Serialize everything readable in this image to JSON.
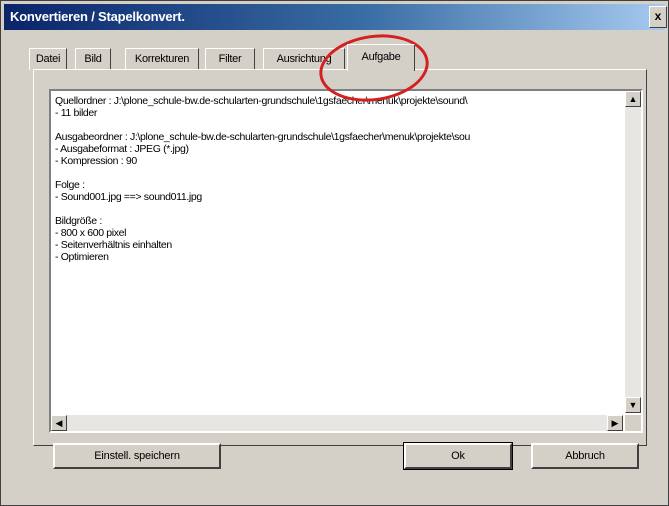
{
  "window": {
    "title": "Konvertieren / Stapelkonvert.",
    "close_label": "x"
  },
  "tabs": [
    {
      "label": "Datei"
    },
    {
      "label": "Bild"
    },
    {
      "label": "Korrekturen"
    },
    {
      "label": "Filter"
    },
    {
      "label": "Ausrichtung"
    },
    {
      "label": "Aufgabe"
    }
  ],
  "active_tab": "Aufgabe",
  "task_text": {
    "lines": [
      "Quellordner : J:\\plone_schule-bw.de-schularten-grundschule\\1gsfaecher\\menuk\\projekte\\sound\\",
      "- 11 bilder",
      "",
      "Ausgabeordner : J:\\plone_schule-bw.de-schularten-grundschule\\1gsfaecher\\menuk\\projekte\\sou",
      "- Ausgabeformat : JPEG (*.jpg)",
      "- Kompression : 90",
      "",
      "Folge :",
      "- Sound001.jpg ==> sound011.jpg",
      "",
      "Bildgröße :",
      "- 800 x 600 pixel",
      "- Seitenverhältnis einhalten",
      "- Optimieren"
    ]
  },
  "buttons": {
    "save_settings": "Einstell. speichern",
    "ok": "Ok",
    "cancel": "Abbruch"
  },
  "colors": {
    "annotation_circle": "#d42020",
    "titlebar": "#0a246a"
  }
}
